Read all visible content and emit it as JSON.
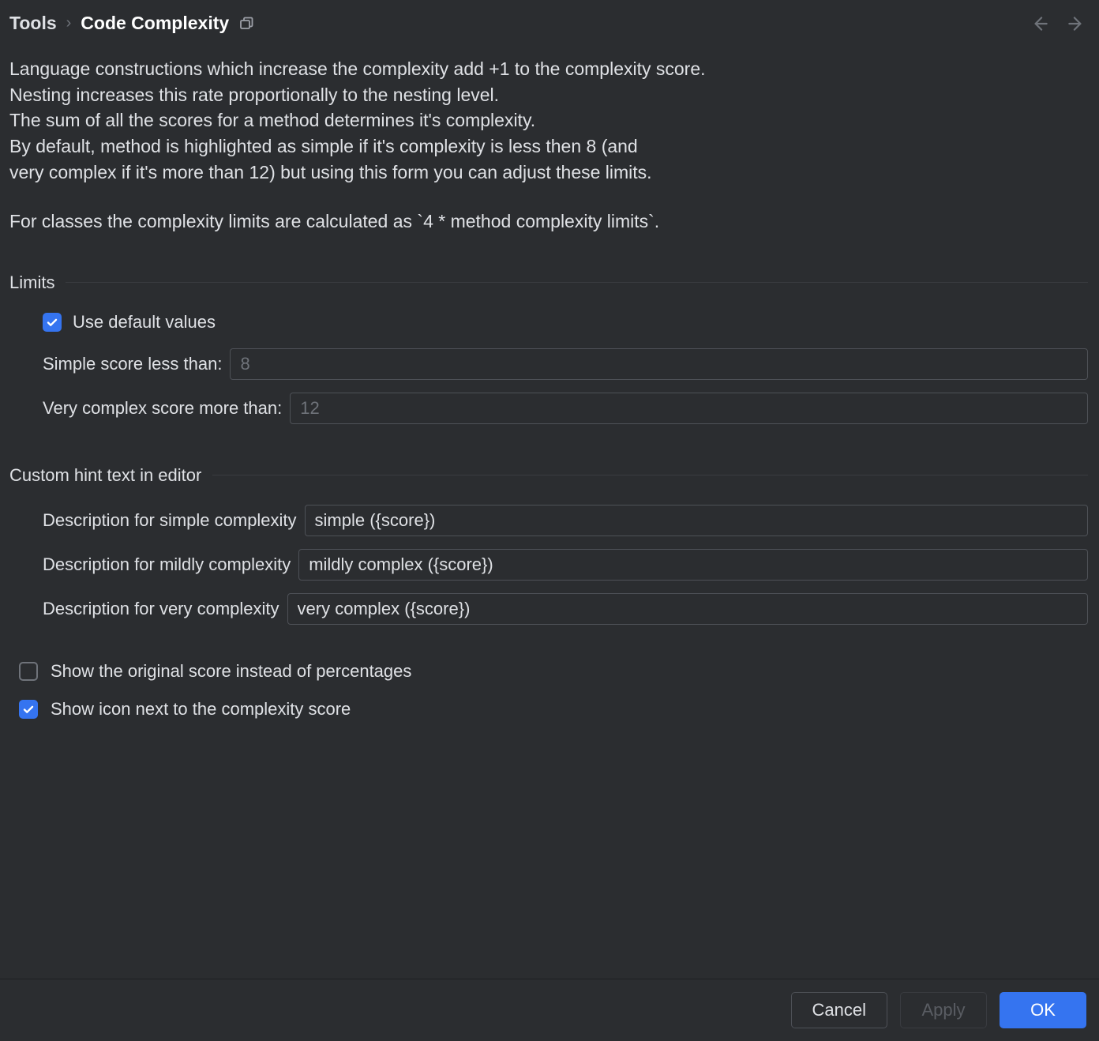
{
  "breadcrumb": {
    "parent": "Tools",
    "current": "Code Complexity"
  },
  "description": {
    "line1": "Language constructions which increase the complexity add +1 to the complexity score.",
    "line2": "Nesting increases this rate proportionally to the nesting level.",
    "line3": "The sum of all the scores for a method determines it's complexity.",
    "line4": "By default, method is highlighted as simple if it's complexity is less then 8 (and",
    "line5": "very complex if it's more than 12) but using this form you can adjust these limits.",
    "line6": "For classes the complexity limits are calculated as `4 * method complexity limits`."
  },
  "sections": {
    "limits": {
      "title": "Limits",
      "use_default_label": "Use default values",
      "use_default_checked": true,
      "simple_label": "Simple score less than:",
      "simple_value": "8",
      "complex_label": "Very complex score more than:",
      "complex_value": "12"
    },
    "hints": {
      "title": "Custom hint text in editor",
      "simple_label": "Description for simple complexity",
      "simple_value": "simple ({score})",
      "mildly_label": "Description for mildly complexity",
      "mildly_value": "mildly complex ({score})",
      "very_label": "Description for very complexity",
      "very_value": "very complex ({score})"
    }
  },
  "options": {
    "show_original_label": "Show the original score instead of percentages",
    "show_original_checked": false,
    "show_icon_label": "Show icon next to the complexity score",
    "show_icon_checked": true
  },
  "buttons": {
    "cancel": "Cancel",
    "apply": "Apply",
    "ok": "OK"
  }
}
